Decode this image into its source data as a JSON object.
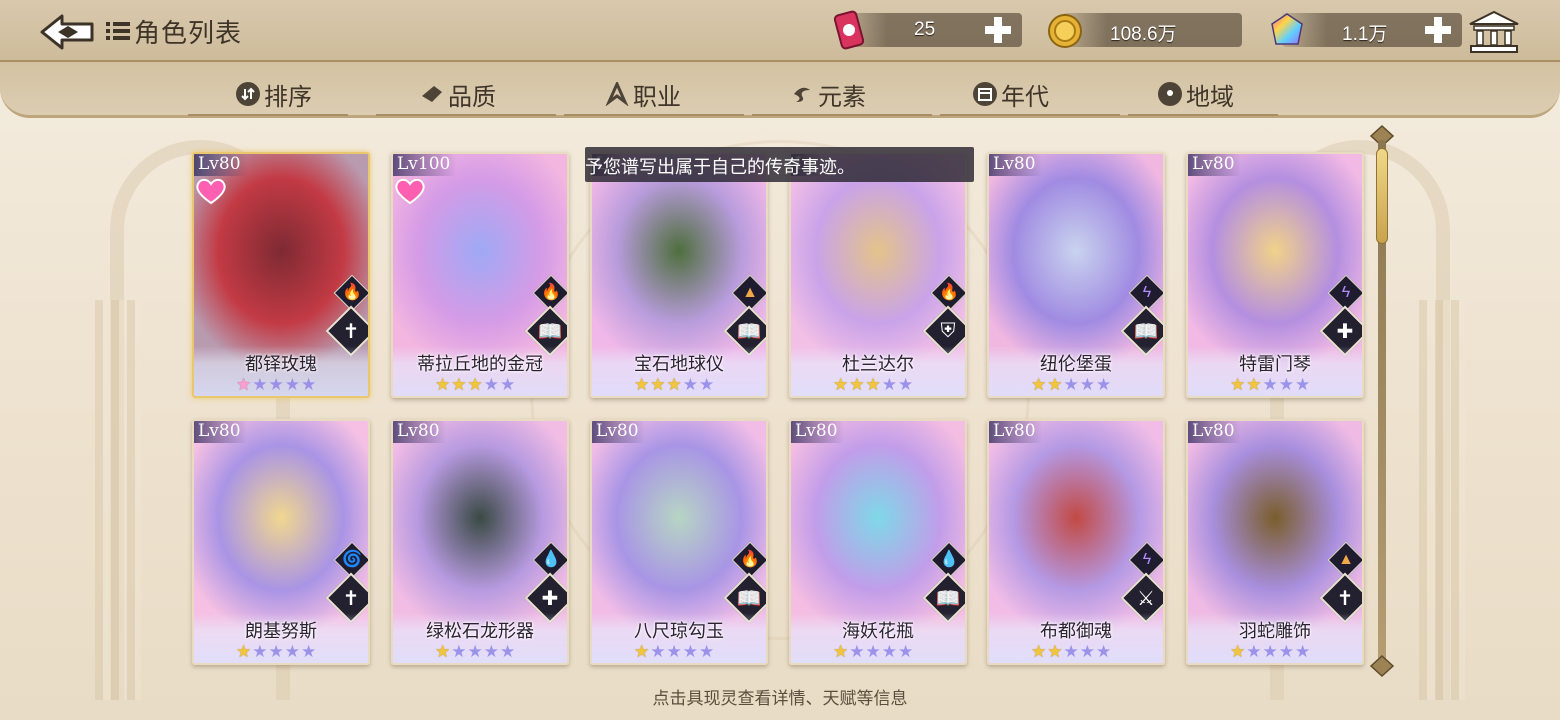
{
  "header": {
    "title": "角色列表",
    "resources": [
      {
        "name": "stamina",
        "value": "25",
        "icon": "ticket-icon"
      },
      {
        "name": "gold",
        "value": "108.6万",
        "icon": "gold-coin-icon"
      },
      {
        "name": "gem",
        "value": "1.1万",
        "icon": "rainbow-gem-icon"
      }
    ]
  },
  "tabs": [
    {
      "label": "排序",
      "icon": "sort-icon"
    },
    {
      "label": "品质",
      "icon": "quality-icon"
    },
    {
      "label": "职业",
      "icon": "class-icon"
    },
    {
      "label": "元素",
      "icon": "element-icon"
    },
    {
      "label": "年代",
      "icon": "era-icon"
    },
    {
      "label": "地域",
      "icon": "location-pin-icon"
    }
  ],
  "tooltip": "予您谱写出属于自己的传奇事迹。",
  "hint": "点击具现灵查看详情、天赋等信息",
  "colors": {
    "fire": "#ff5a2a",
    "lightning": "#b48cff",
    "water": "#49a8ff",
    "earth": "#f0a84a",
    "wind": "#43d0c7",
    "star_on": "#f2c53a",
    "star_off": "#8f86e8"
  },
  "characters": [
    {
      "lv_prefix": "Lv",
      "level": "80",
      "name": "都铎玫瑰",
      "stars": 1,
      "star_style": "pink",
      "favorite": true,
      "element": "fire",
      "class": "sword"
    },
    {
      "lv_prefix": "Lv",
      "level": "100",
      "name": "蒂拉丘地的金冠",
      "stars": 3,
      "star_style": "gold",
      "favorite": true,
      "element": "fire",
      "class": "book"
    },
    {
      "lv_prefix": "Lv",
      "level": "",
      "name": "宝石地球仪",
      "stars": 3,
      "star_style": "gold",
      "favorite": false,
      "element": "earth",
      "class": "book"
    },
    {
      "lv_prefix": "Lv",
      "level": "",
      "name": "杜兰达尔",
      "stars": 3,
      "star_style": "gold",
      "favorite": false,
      "element": "fire",
      "class": "shield"
    },
    {
      "lv_prefix": "Lv",
      "level": "80",
      "name": "纽伦堡蛋",
      "stars": 2,
      "star_style": "gold",
      "favorite": false,
      "element": "lightning",
      "class": "book"
    },
    {
      "lv_prefix": "Lv",
      "level": "80",
      "name": "特雷门琴",
      "stars": 2,
      "star_style": "gold",
      "favorite": false,
      "element": "lightning",
      "class": "cross"
    },
    {
      "lv_prefix": "Lv",
      "level": "80",
      "name": "朗基努斯",
      "stars": 1,
      "star_style": "gold",
      "favorite": false,
      "element": "wind",
      "class": "sword"
    },
    {
      "lv_prefix": "Lv",
      "level": "80",
      "name": "绿松石龙形器",
      "stars": 1,
      "star_style": "gold",
      "favorite": false,
      "element": "water",
      "class": "cross"
    },
    {
      "lv_prefix": "Lv",
      "level": "80",
      "name": "八尺琼勾玉",
      "stars": 1,
      "star_style": "gold",
      "favorite": false,
      "element": "fire",
      "class": "book"
    },
    {
      "lv_prefix": "Lv",
      "level": "80",
      "name": "海妖花瓶",
      "stars": 1,
      "star_style": "gold",
      "favorite": false,
      "element": "water",
      "class": "book"
    },
    {
      "lv_prefix": "Lv",
      "level": "80",
      "name": "布都御魂",
      "stars": 2,
      "star_style": "gold",
      "favorite": false,
      "element": "lightning",
      "class": "crossed-swords"
    },
    {
      "lv_prefix": "Lv",
      "level": "80",
      "name": "羽蛇雕饰",
      "stars": 1,
      "star_style": "gold",
      "favorite": false,
      "element": "earth",
      "class": "sword"
    }
  ]
}
